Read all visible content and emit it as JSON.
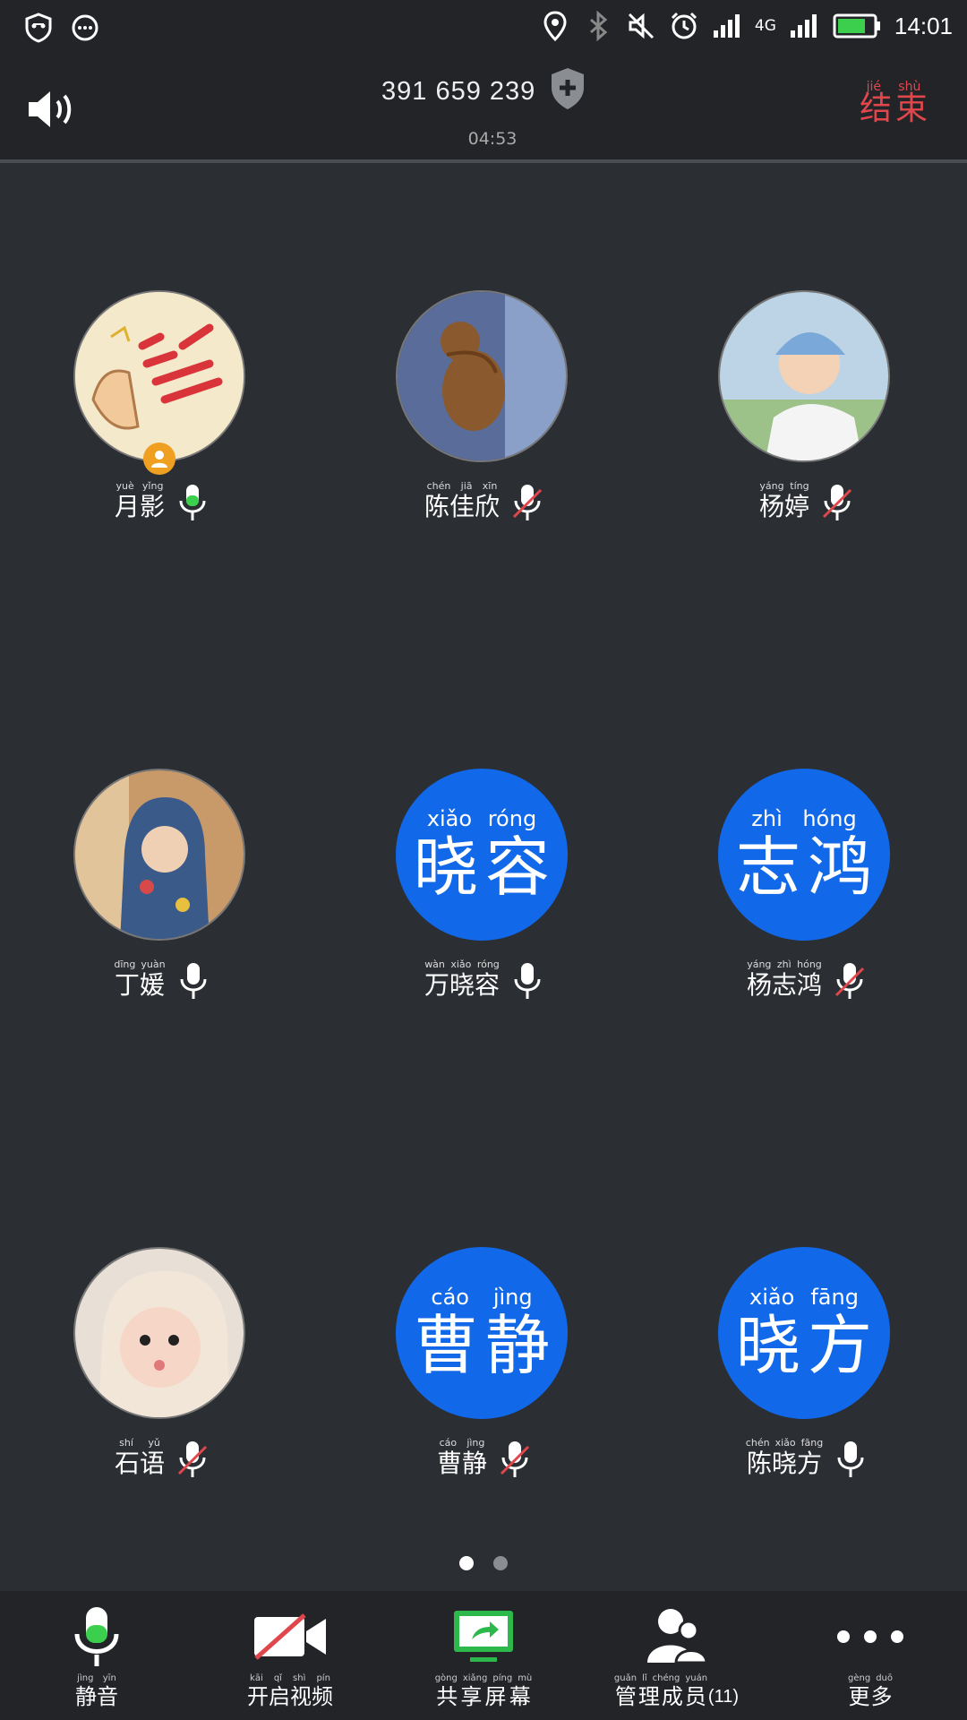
{
  "status_bar": {
    "time": "14:01",
    "network": "4G",
    "icons": [
      "shield-face-icon",
      "chat-bubble-icon",
      "location-icon",
      "bluetooth-icon",
      "mute-icon",
      "alarm-icon",
      "signal-icon",
      "signal-4g-icon",
      "battery-icon"
    ]
  },
  "header": {
    "meeting_id": "391 659 239",
    "timer": "04:53",
    "end_button": {
      "pinyin": [
        "jié",
        "shù"
      ],
      "hanzi": [
        "结",
        "束"
      ]
    },
    "colors": {
      "end": "#e0474c"
    }
  },
  "participants": [
    {
      "name": [
        "月",
        "影"
      ],
      "pinyin": [
        "yuè",
        "yǐng"
      ],
      "avatar": "photo-thumb-jiayou",
      "host": true,
      "mic": "on-active"
    },
    {
      "name": [
        "陈",
        "佳",
        "欣"
      ],
      "pinyin": [
        "chén",
        "jiā",
        "xīn"
      ],
      "avatar": "photo-jerry-mouse",
      "host": false,
      "mic": "muted"
    },
    {
      "name": [
        "杨",
        "婷"
      ],
      "pinyin": [
        "yáng",
        "tíng"
      ],
      "avatar": "photo-boy-helmet",
      "host": false,
      "mic": "muted"
    },
    {
      "name": [
        "丁",
        "媛"
      ],
      "pinyin": [
        "dīng",
        "yuàn"
      ],
      "avatar": "photo-woman-scarf",
      "host": false,
      "mic": "on"
    },
    {
      "name": [
        "万",
        "晓",
        "容"
      ],
      "pinyin": [
        "wàn",
        "xiǎo",
        "róng"
      ],
      "avatar_text": {
        "pinyin": [
          "xiǎo",
          "róng"
        ],
        "hanzi": [
          "晓",
          "容"
        ]
      },
      "host": false,
      "mic": "on"
    },
    {
      "name": [
        "杨",
        "志",
        "鸿"
      ],
      "pinyin": [
        "yáng",
        "zhì",
        "hóng"
      ],
      "avatar_text": {
        "pinyin": [
          "zhì",
          "hóng"
        ],
        "hanzi": [
          "志",
          "鸿"
        ]
      },
      "host": false,
      "mic": "muted"
    },
    {
      "name": [
        "石",
        "语"
      ],
      "pinyin": [
        "shí",
        "yǔ"
      ],
      "avatar": "photo-baby-hat",
      "host": false,
      "mic": "muted"
    },
    {
      "name": [
        "曹",
        "静"
      ],
      "pinyin": [
        "cáo",
        "jìng"
      ],
      "avatar_text": {
        "pinyin": [
          "cáo",
          "jìng"
        ],
        "hanzi": [
          "曹",
          "静"
        ]
      },
      "host": false,
      "mic": "muted"
    },
    {
      "name": [
        "陈",
        "晓",
        "方"
      ],
      "pinyin": [
        "chén",
        "xiǎo",
        "fāng"
      ],
      "avatar_text": {
        "pinyin": [
          "xiǎo",
          "fāng"
        ],
        "hanzi": [
          "晓",
          "方"
        ]
      },
      "host": false,
      "mic": "on"
    }
  ],
  "pager": {
    "pages": 2,
    "current": 1
  },
  "toolbar": [
    {
      "id": "mute",
      "pinyin": [
        "jìng",
        "yīn"
      ],
      "hanzi": [
        "静",
        "音"
      ],
      "icon": "microphone-icon"
    },
    {
      "id": "video",
      "pinyin": [
        "kāi",
        "qǐ",
        "shì",
        "pín"
      ],
      "hanzi": [
        "开",
        "启",
        "视",
        "频"
      ],
      "icon": "video-off-icon"
    },
    {
      "id": "share",
      "pinyin": [
        "gòng",
        "xiǎng",
        "píng",
        "mù"
      ],
      "hanzi": [
        "共",
        "享",
        "屏",
        "幕"
      ],
      "icon": "share-screen-icon"
    },
    {
      "id": "members",
      "pinyin": [
        "guǎn",
        "lǐ",
        "chéng",
        "yuán"
      ],
      "hanzi": [
        "管",
        "理",
        "成",
        "员"
      ],
      "suffix": "(11)",
      "icon": "members-icon"
    },
    {
      "id": "more",
      "pinyin": [
        "gèng",
        "duō"
      ],
      "hanzi": [
        "更",
        "多"
      ],
      "icon": "more-icon"
    }
  ],
  "colors": {
    "background": "#2b2e33",
    "bar": "#222428",
    "accent_blue": "#1168e8",
    "mic_green": "#3ccf4e",
    "muted_red": "#e0474c",
    "host_badge": "#f0a020"
  }
}
